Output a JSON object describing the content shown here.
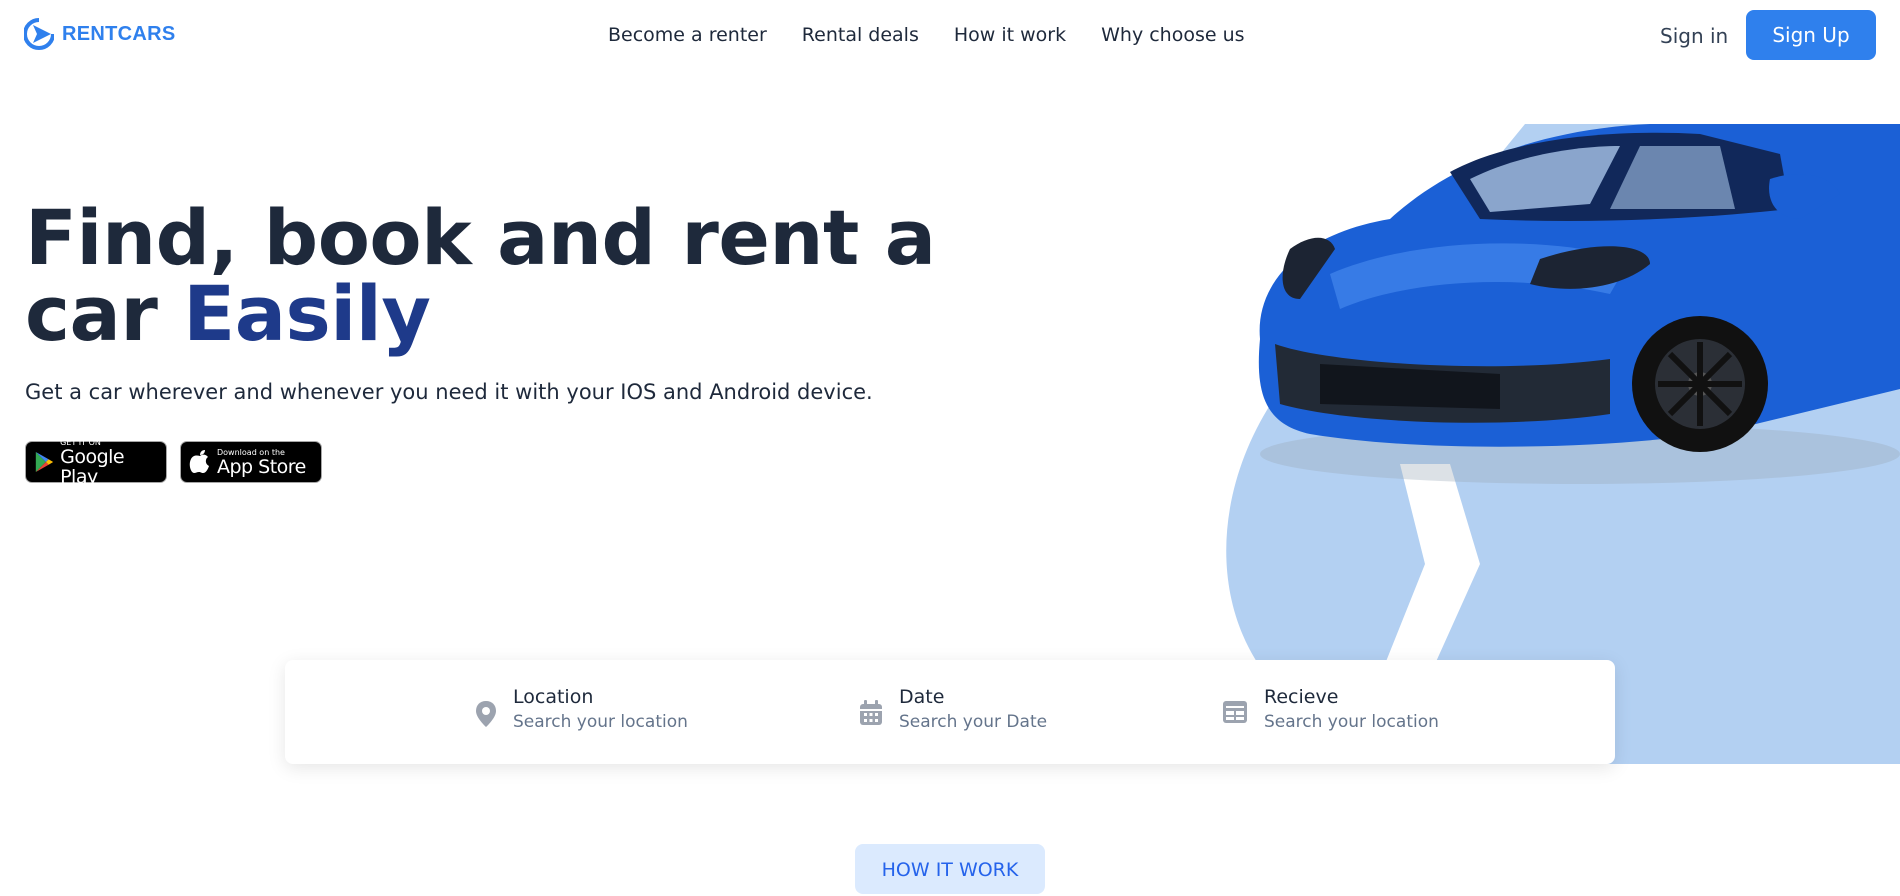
{
  "header": {
    "logo_text": "RENTCARS",
    "nav": [
      "Become a renter",
      "Rental deals",
      "How it work",
      "Why choose us"
    ],
    "sign_in": "Sign in",
    "sign_up": "Sign Up"
  },
  "hero": {
    "title_line1": "Find, book and rent a",
    "title_line2_prefix": "car ",
    "title_accent": "Easily",
    "subtitle": "Get a car wherever and whenever you need it with your IOS and Android device.",
    "google_play": {
      "small": "GET IT ON",
      "big": "Google Play"
    },
    "app_store": {
      "small": "Download on the",
      "big": "App Store"
    }
  },
  "search": [
    {
      "label": "Location",
      "placeholder": "Search your location",
      "icon": "location-pin-icon"
    },
    {
      "label": "Date",
      "placeholder": "Search your Date",
      "icon": "calendar-icon"
    },
    {
      "label": "Recieve",
      "placeholder": "Search your location",
      "icon": "receive-icon"
    }
  ],
  "section_badge": "HOW IT WORK",
  "colors": {
    "primary": "#2f80ed",
    "accent_text": "#1e3a8a",
    "decor_blue": "#b3d0f2",
    "car_blue": "#1b60d6",
    "badge_bg": "#dbeafe"
  }
}
